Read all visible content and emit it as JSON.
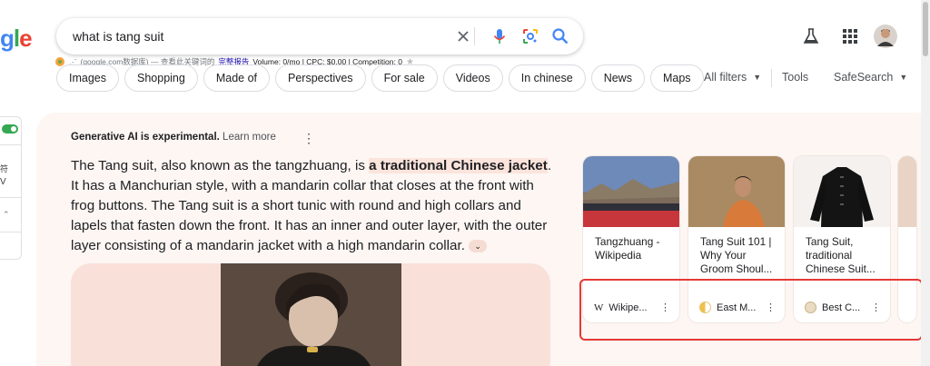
{
  "logo": {
    "p1": "g",
    "p2": "l",
    "p3": "e"
  },
  "search": {
    "query": "what is tang suit"
  },
  "seo_bar": {
    "source": "(google.com数据库) — 查看此关键词的",
    "report_link": "完整报告",
    "metrics": "Volume: 0/mo | CPC: $0.00 | Competition: 0"
  },
  "chips": [
    "Images",
    "Shopping",
    "Made of",
    "Perspectives",
    "For sale",
    "Videos",
    "In chinese",
    "News",
    "Maps"
  ],
  "tools": {
    "all_filters": "All filters",
    "tools": "Tools",
    "safesearch": "SafeSearch"
  },
  "left_panel": {
    "t1": "符",
    "t2": "V"
  },
  "ai": {
    "header": "Generative AI is experimental.",
    "learn_more": "Learn more",
    "text_before": "The Tang suit, also known as the tangzhuang, is ",
    "highlight": "a traditional Chinese jacket",
    "text_after": ". It has a Manchurian style, with a mandarin collar that closes at the front with frog buttons. The Tang suit is a short tunic with round and high collars and lapels that fasten down the front. It has an inner and outer layer, with the outer layer consisting of a mandarin jacket with a high mandarin collar."
  },
  "sources": [
    {
      "title": "Tangzhuang - Wikipedia",
      "site": "Wikipe...",
      "favicon": "W"
    },
    {
      "title": "Tang Suit 101 | Why Your Groom Shoul...",
      "site": "East M...",
      "favicon": ""
    },
    {
      "title": "Tang Suit, traditional Chinese Suit...",
      "site": "Best C...",
      "favicon": ""
    }
  ],
  "colors": {
    "accent_blue": "#4285f4",
    "highlight_red": "#e53935",
    "ai_background": "#fdf6f3"
  }
}
